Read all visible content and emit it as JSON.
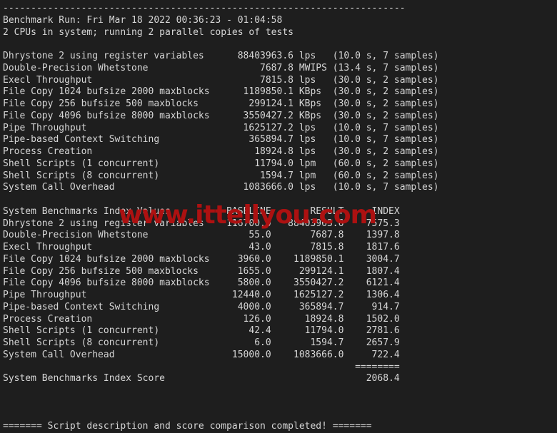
{
  "terminal": {
    "background_color": "#1e1e1e",
    "foreground_color": "#d6d6d6",
    "top_rule": "------------------------------------------------------------------------",
    "benchmark_run_line": "Benchmark Run: Fri Mar 18 2022 00:36:23 - 01:04:58",
    "cpu_line": "2 CPUs in system; running 2 parallel copies of tests",
    "footer_line": "======= Script description and score comparison completed! ======="
  },
  "watermark": {
    "text": "www.ittellyou.com",
    "color": "#ad1111"
  },
  "results_section": {
    "rows": [
      {
        "label": "Dhrystone 2 using register variables",
        "value": "88403963.6",
        "unit": "lps",
        "timing": "(10.0 s, 7 samples)"
      },
      {
        "label": "Double-Precision Whetstone",
        "value": "7687.8",
        "unit": "MWIPS",
        "timing": "(13.4 s, 7 samples)"
      },
      {
        "label": "Execl Throughput",
        "value": "7815.8",
        "unit": "lps",
        "timing": "(30.0 s, 2 samples)"
      },
      {
        "label": "File Copy 1024 bufsize 2000 maxblocks",
        "value": "1189850.1",
        "unit": "KBps",
        "timing": "(30.0 s, 2 samples)"
      },
      {
        "label": "File Copy 256 bufsize 500 maxblocks",
        "value": "299124.1",
        "unit": "KBps",
        "timing": "(30.0 s, 2 samples)"
      },
      {
        "label": "File Copy 4096 bufsize 8000 maxblocks",
        "value": "3550427.2",
        "unit": "KBps",
        "timing": "(30.0 s, 2 samples)"
      },
      {
        "label": "Pipe Throughput",
        "value": "1625127.2",
        "unit": "lps",
        "timing": "(10.0 s, 7 samples)"
      },
      {
        "label": "Pipe-based Context Switching",
        "value": "365894.7",
        "unit": "lps",
        "timing": "(10.0 s, 7 samples)"
      },
      {
        "label": "Process Creation",
        "value": "18924.8",
        "unit": "lps",
        "timing": "(30.0 s, 2 samples)"
      },
      {
        "label": "Shell Scripts (1 concurrent)",
        "value": "11794.0",
        "unit": "lpm",
        "timing": "(60.0 s, 2 samples)"
      },
      {
        "label": "Shell Scripts (8 concurrent)",
        "value": "1594.7",
        "unit": "lpm",
        "timing": "(60.0 s, 2 samples)"
      },
      {
        "label": "System Call Overhead",
        "value": "1083666.0",
        "unit": "lps",
        "timing": "(10.0 s, 7 samples)"
      }
    ]
  },
  "index_section": {
    "title": "System Benchmarks Index Values",
    "headers": {
      "baseline": "BASELINE",
      "result": "RESULT",
      "index": "INDEX"
    },
    "rows": [
      {
        "label": "Dhrystone 2 using register variables",
        "baseline": "116700.0",
        "result": "88403963.6",
        "index": "7575.3"
      },
      {
        "label": "Double-Precision Whetstone",
        "baseline": "55.0",
        "result": "7687.8",
        "index": "1397.8"
      },
      {
        "label": "Execl Throughput",
        "baseline": "43.0",
        "result": "7815.8",
        "index": "1817.6"
      },
      {
        "label": "File Copy 1024 bufsize 2000 maxblocks",
        "baseline": "3960.0",
        "result": "1189850.1",
        "index": "3004.7"
      },
      {
        "label": "File Copy 256 bufsize 500 maxblocks",
        "baseline": "1655.0",
        "result": "299124.1",
        "index": "1807.4"
      },
      {
        "label": "File Copy 4096 bufsize 8000 maxblocks",
        "baseline": "5800.0",
        "result": "3550427.2",
        "index": "6121.4"
      },
      {
        "label": "Pipe Throughput",
        "baseline": "12440.0",
        "result": "1625127.2",
        "index": "1306.4"
      },
      {
        "label": "Pipe-based Context Switching",
        "baseline": "4000.0",
        "result": "365894.7",
        "index": "914.7"
      },
      {
        "label": "Process Creation",
        "baseline": "126.0",
        "result": "18924.8",
        "index": "1502.0"
      },
      {
        "label": "Shell Scripts (1 concurrent)",
        "baseline": "42.4",
        "result": "11794.0",
        "index": "2781.6"
      },
      {
        "label": "Shell Scripts (8 concurrent)",
        "baseline": "6.0",
        "result": "1594.7",
        "index": "2657.9"
      },
      {
        "label": "System Call Overhead",
        "baseline": "15000.0",
        "result": "1083666.0",
        "index": "722.4"
      }
    ],
    "separator": "========",
    "score_label": "System Benchmarks Index Score",
    "score_value": "2068.4"
  }
}
